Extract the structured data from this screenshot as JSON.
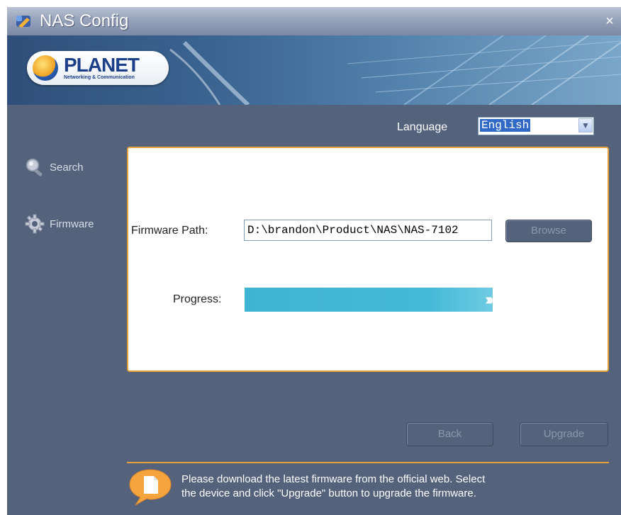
{
  "window": {
    "title": "NAS Config",
    "close_symbol": "×"
  },
  "banner": {
    "logo_text": "PLANET",
    "logo_subtitle": "Networking & Communication"
  },
  "language": {
    "label": "Language",
    "selected": "English",
    "arrow_symbol": "▼"
  },
  "sidebar": {
    "items": [
      {
        "label": "Search",
        "icon": "magnifier-icon"
      },
      {
        "label": "Firmware",
        "icon": "gear-icon"
      }
    ]
  },
  "firmware": {
    "path_label": "Firmware Path:",
    "path_value": "D:\\brandon\\Product\\NAS\\NAS-7102",
    "browse_label": "Browse",
    "progress_label": "Progress:",
    "progress_value": 1.0,
    "progress_chevrons": "›››››"
  },
  "footer": {
    "back_label": "Back",
    "upgrade_label": "Upgrade",
    "info_line1": "Please download the latest firmware from the official web. Select",
    "info_line2": "the device and click \"Upgrade\" button to  upgrade the firmware."
  },
  "colors": {
    "background": "#55627c",
    "accent": "#e9a13b",
    "progress": "#45bad8"
  }
}
